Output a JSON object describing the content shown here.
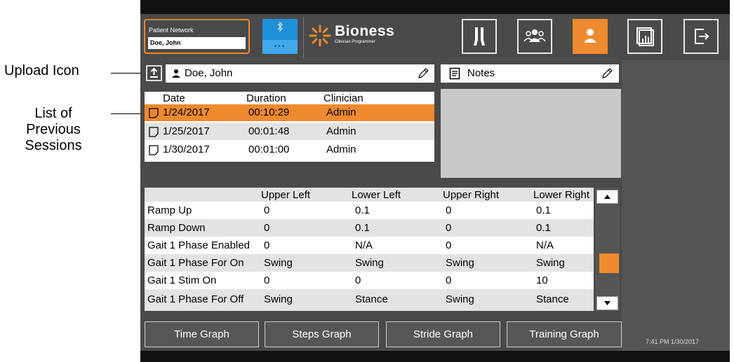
{
  "callouts": {
    "upload": "Upload Icon",
    "sessions": [
      "List of",
      "Previous",
      "Sessions"
    ]
  },
  "header": {
    "patient_network_label": "Patient Network",
    "patient_network_value": "Doe, John",
    "bluetooth_dots": "•••",
    "logo": "Bioness",
    "logo_sub": "Clinician Programmer",
    "nav": [
      "legs-icon",
      "group-icon",
      "person-icon",
      "report-icon",
      "exit-icon"
    ]
  },
  "patient": {
    "name": "Doe, John"
  },
  "notes": {
    "label": "Notes"
  },
  "sessions": {
    "columns": [
      "Date",
      "Duration",
      "Clinician"
    ],
    "rows": [
      {
        "date": "1/24/2017",
        "duration": "00:10:29",
        "clinician": "Admin"
      },
      {
        "date": "1/25/2017",
        "duration": "00:01:48",
        "clinician": "Admin"
      },
      {
        "date": "1/30/2017",
        "duration": "00:01:00",
        "clinician": "Admin"
      }
    ]
  },
  "params": {
    "columns": [
      "Upper Left",
      "Lower Left",
      "Upper Right",
      "Lower Right"
    ],
    "rows": [
      {
        "name": "Ramp Up",
        "ul": "0",
        "ll": "0.1",
        "ur": "0",
        "lr": "0.1"
      },
      {
        "name": "Ramp Down",
        "ul": "0",
        "ll": "0.1",
        "ur": "0",
        "lr": "0.1"
      },
      {
        "name": "Gait 1 Phase Enabled",
        "ul": "0",
        "ll": "N/A",
        "ur": "0",
        "lr": "N/A"
      },
      {
        "name": "Gait 1 Phase For On",
        "ul": "Swing",
        "ll": "Swing",
        "ur": "Swing",
        "lr": "Swing"
      },
      {
        "name": "Gait 1 Stim On",
        "ul": "0",
        "ll": "0",
        "ur": "0",
        "lr": "10"
      },
      {
        "name": "Gait 1 Phase For Off",
        "ul": "Swing",
        "ll": "Stance",
        "ur": "Swing",
        "lr": "Stance"
      }
    ]
  },
  "graphs": [
    "Time Graph",
    "Steps Graph",
    "Stride Graph",
    "Training Graph"
  ],
  "status": {
    "datetime": "7:41 PM 1/30/2017"
  },
  "colors": {
    "accent": "#f08a2e",
    "panel": "#4a4a4a",
    "bluetooth": "#1f8fd8"
  }
}
